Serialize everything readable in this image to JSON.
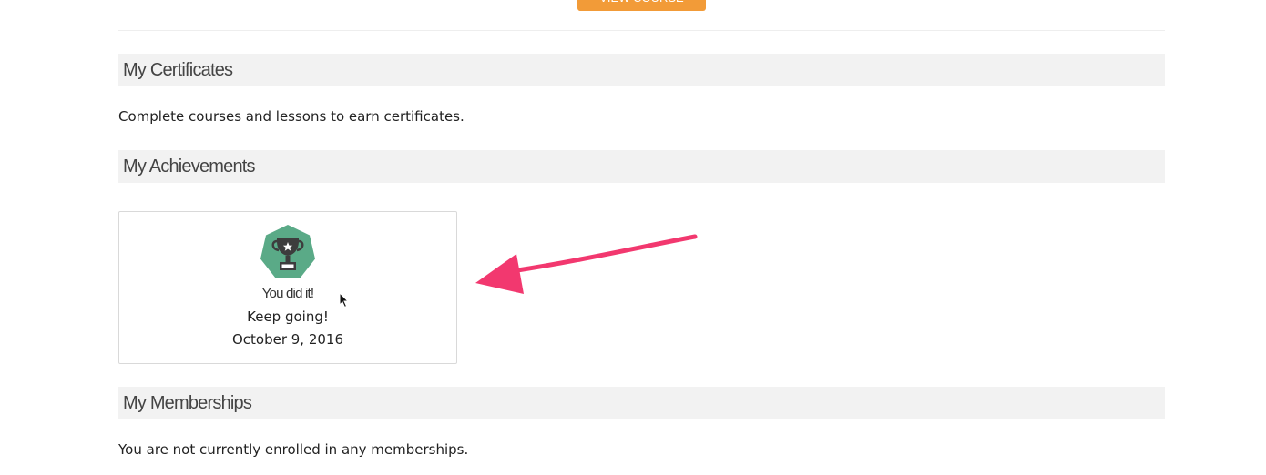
{
  "top_button": {
    "label": "VIEW COURSE"
  },
  "certificates": {
    "heading": "My Certificates",
    "text": "Complete courses and lessons to earn certificates."
  },
  "achievements": {
    "heading": "My Achievements",
    "items": [
      {
        "icon": "trophy-icon",
        "title": "You did it!",
        "message": "Keep going!",
        "date": "October 9, 2016"
      }
    ]
  },
  "memberships": {
    "heading": "My Memberships",
    "text": "You are not currently enrolled in any memberships."
  },
  "colors": {
    "accent_button": "#f29b38",
    "badge": "#5aaa87",
    "annotation_arrow": "#f2386f"
  }
}
